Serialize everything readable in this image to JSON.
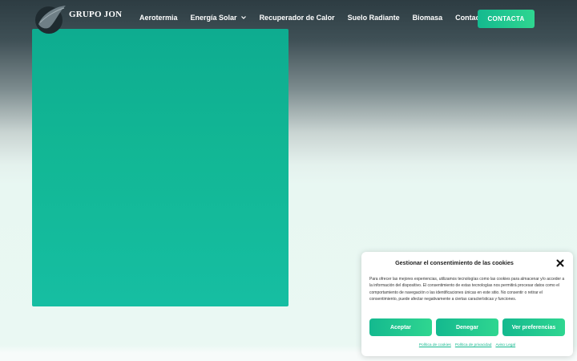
{
  "header": {
    "brand": "GRUPO JON",
    "nav": [
      {
        "label": "Aerotermia"
      },
      {
        "label": "Energía Solar",
        "has_dropdown": true
      },
      {
        "label": "Recuperador de Calor"
      },
      {
        "label": "Suelo Radiante"
      },
      {
        "label": "Biomasa"
      },
      {
        "label": "Contacto"
      }
    ],
    "cta_label": "CONTACTA"
  },
  "cookie_banner": {
    "title": "Gestionar el consentimiento de las cookies",
    "body": "Para ofrecer las mejores experiencias, utilizamos tecnologías como las cookies para almacenar y/o acceder a la información del dispositivo. El consentimiento de estas tecnologías nos permitirá procesar datos como el comportamiento de navegación o las identificaciones únicas en este sitio. No consentir o retirar el consentimiento, puede afectar negativamente a ciertas características y funciones.",
    "accept_label": "Aceptar",
    "deny_label": "Denegar",
    "preferences_label": "Ver preferencias",
    "links": [
      "Política de cookies",
      "Política de privacidad",
      "Aviso Legal"
    ]
  },
  "colors": {
    "accent": "#14b98f",
    "accent_light": "#2fd690",
    "hero": "#12b795",
    "header_dark": "#2d3c42"
  }
}
